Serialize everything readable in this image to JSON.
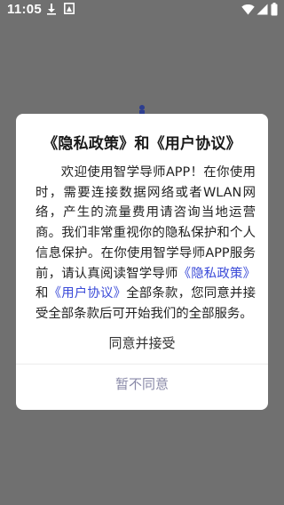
{
  "status_bar": {
    "time": "11:05",
    "icons": [
      "download-icon",
      "image-notification-icon",
      "wifi-icon",
      "signal-icon",
      "battery-icon"
    ]
  },
  "dialog": {
    "title": "《隐私政策》和《用户协议》",
    "body": {
      "text_1": "欢迎使用智学导师APP！在你使用时，需要连接数据网络或者WLAN网络，产生的流量费用请咨询当地运营商。我们非常重视你的隐私保护和个人信息保护。在你使用智学导师APP服务前，请认真阅读智学导师",
      "privacy_link": "《隐私政策》",
      "text_2": "和",
      "agreement_link": "《用户协议》",
      "text_3": "全部条款，您同意并接受全部条款后可开始我们的全部服务。"
    },
    "accept_label": "同意并接受",
    "decline_label": "暂不同意"
  },
  "colors": {
    "overlay": "#707070",
    "dialog_bg": "#ffffff",
    "link": "#3a4ad8",
    "decline": "#8a8aa8"
  }
}
